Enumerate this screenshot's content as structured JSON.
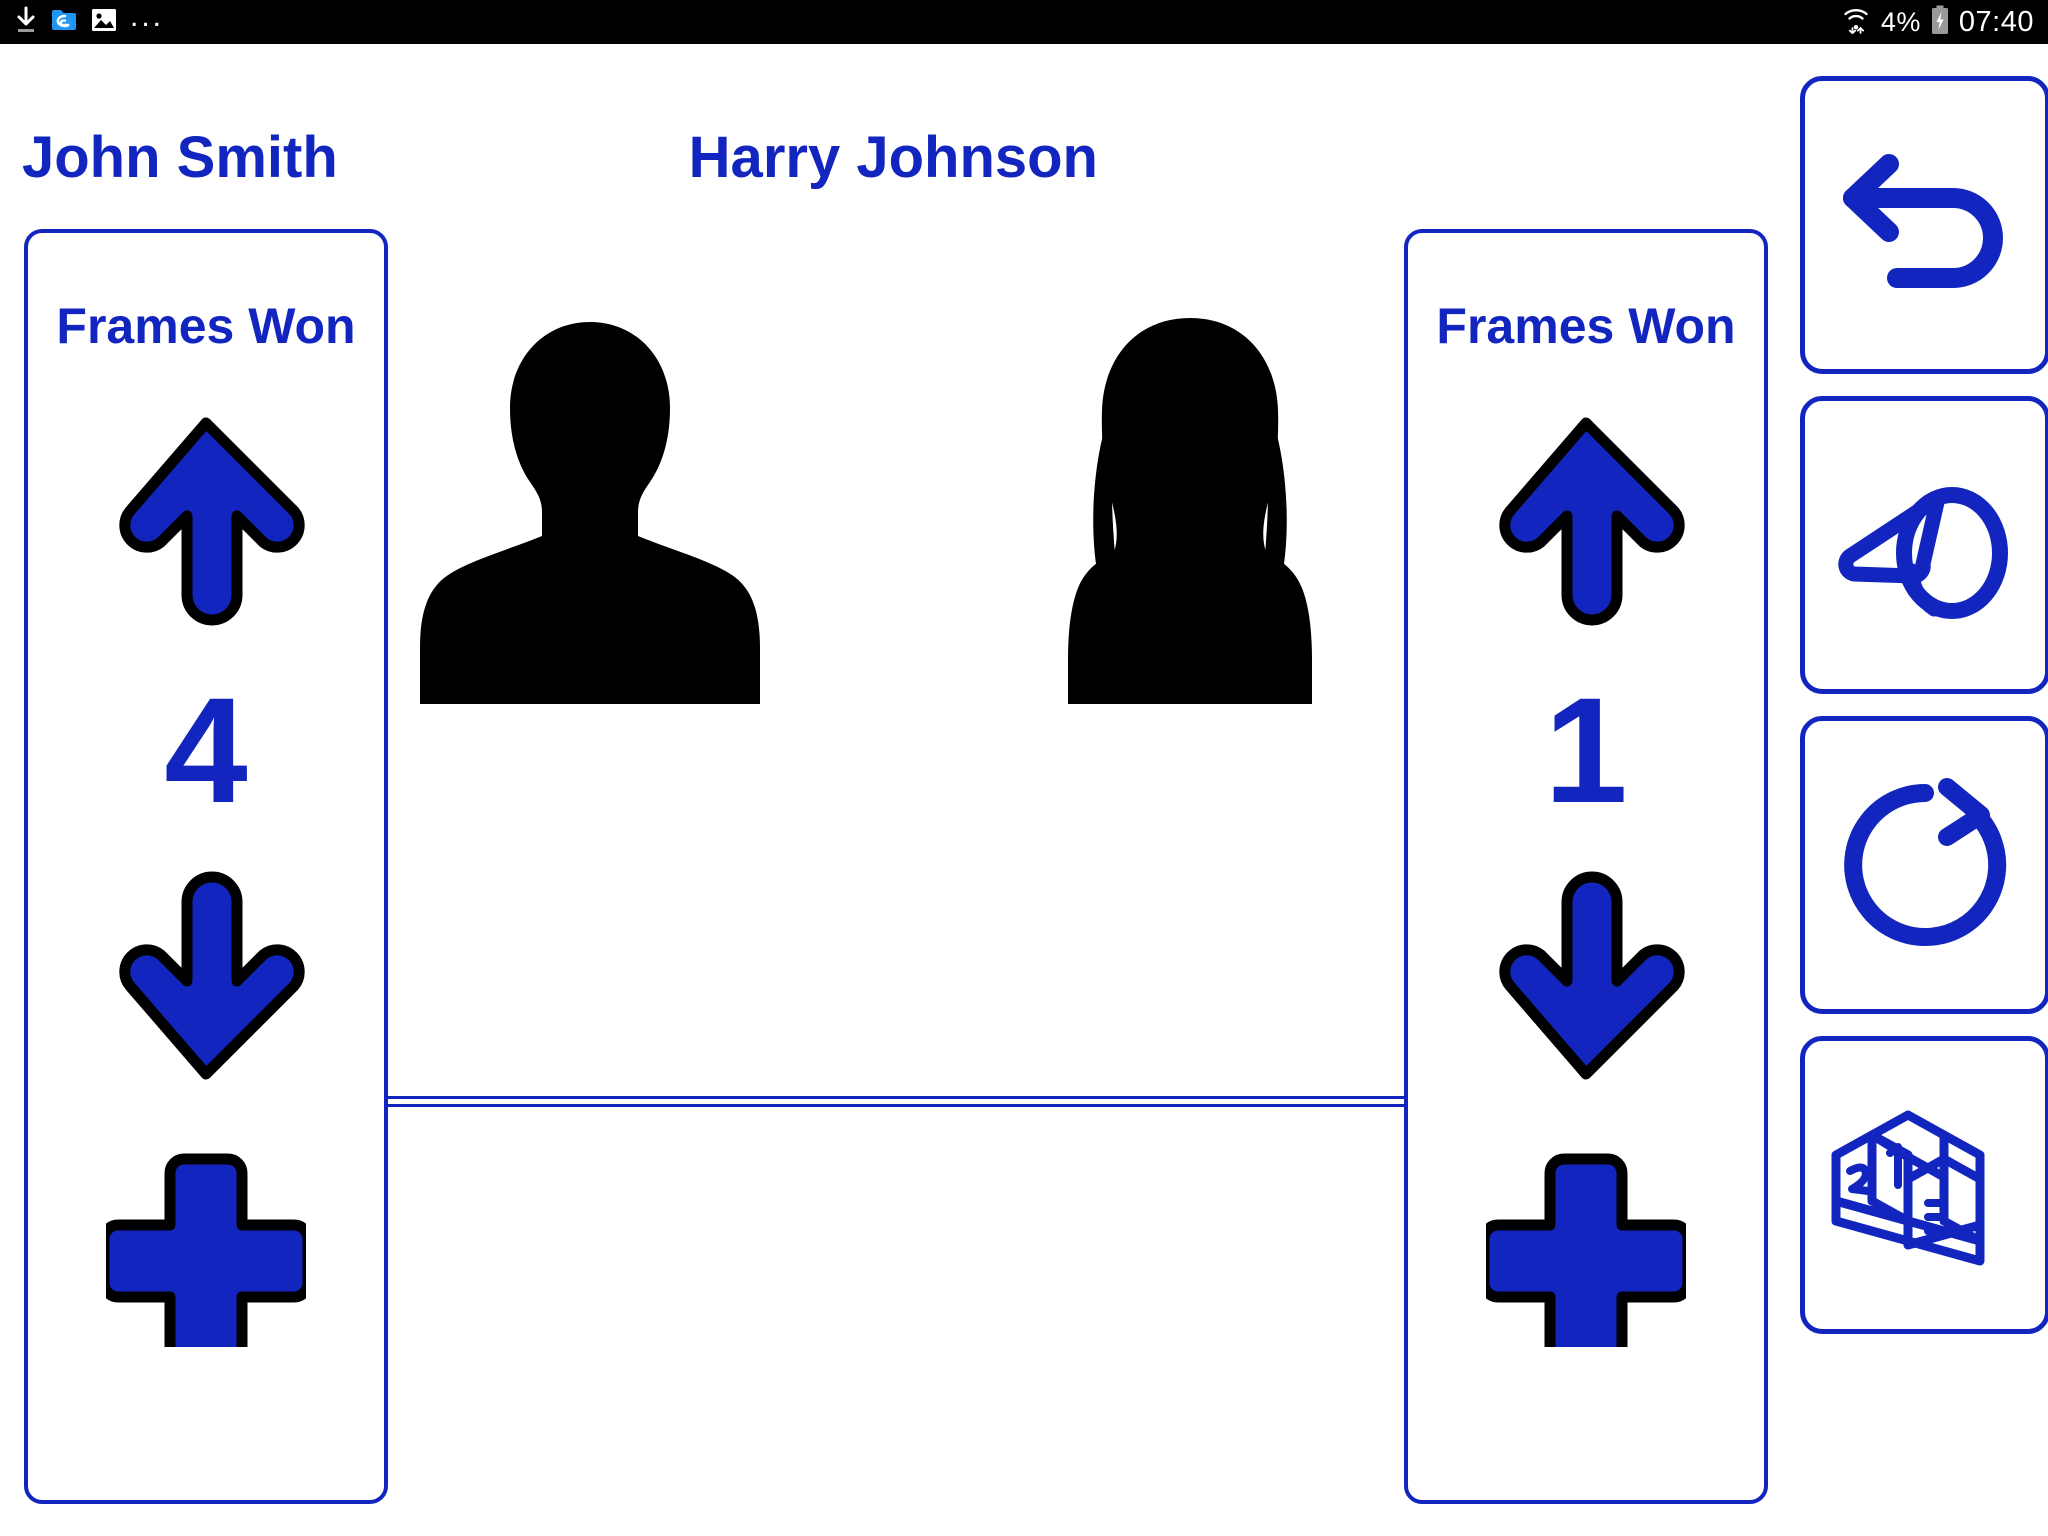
{
  "status_bar": {
    "left_icons": [
      "download-icon",
      "es-file-explorer-icon",
      "gallery-image-icon"
    ],
    "overflow_label": "...",
    "wifi_icon": "wifi-icon",
    "battery_percent": "4%",
    "battery_icon": "battery-charging-icon",
    "clock": "07:40"
  },
  "players": {
    "left": {
      "name": "John Smith",
      "panel_title": "Frames Won",
      "score": "4",
      "avatar_icon": "male-avatar-silhouette",
      "increment_icon": "arrow-up-icon",
      "decrement_icon": "arrow-down-icon",
      "add_icon": "plus-icon"
    },
    "right": {
      "name": "Harry Johnson",
      "panel_title": "Frames Won",
      "score": "1",
      "avatar_icon": "female-avatar-silhouette",
      "increment_icon": "arrow-up-icon",
      "decrement_icon": "arrow-down-icon",
      "add_icon": "plus-icon"
    }
  },
  "toolbar": {
    "buttons": [
      {
        "name": "undo-button",
        "icon": "undo-arrow-icon"
      },
      {
        "name": "referee-button",
        "icon": "whistle-icon"
      },
      {
        "name": "reset-button",
        "icon": "refresh-clockwise-icon"
      },
      {
        "name": "standings-button",
        "icon": "podium-icon"
      }
    ]
  },
  "colors": {
    "brand_blue": "#1226bf",
    "arrow_fill": "#1226bf",
    "arrow_stroke": "#000000",
    "status_bar_bg": "#000000",
    "page_bg": "#ffffff",
    "silhouette": "#000000"
  }
}
